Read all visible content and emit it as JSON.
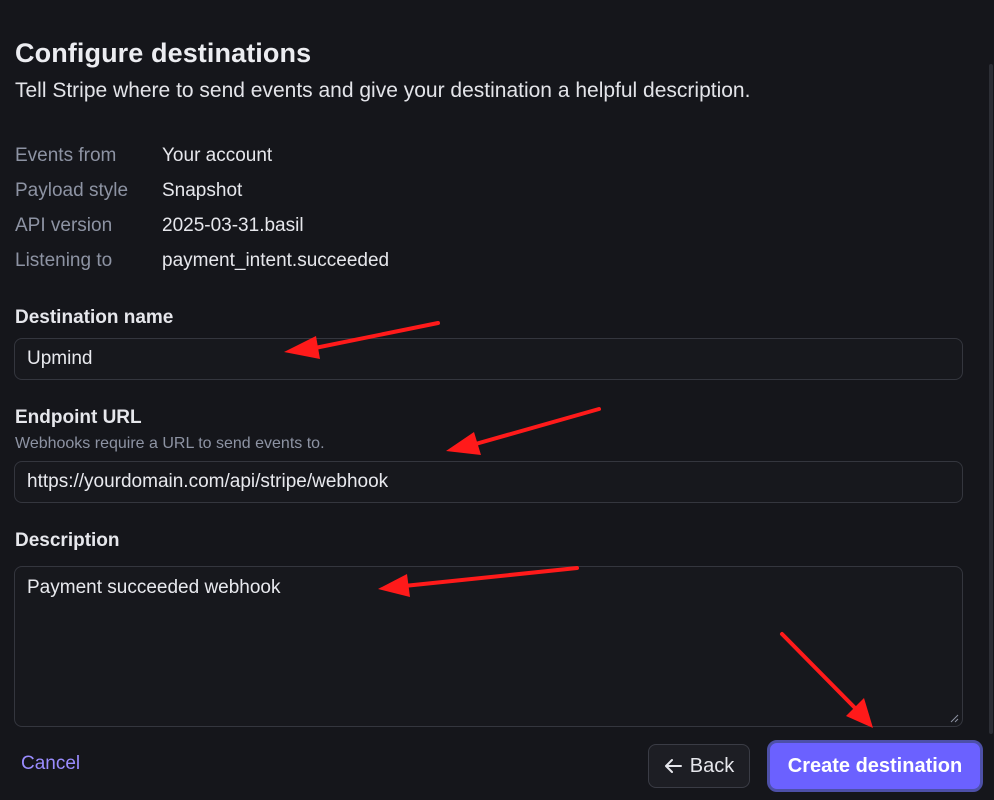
{
  "header": {
    "title": "Configure destinations",
    "subtitle": "Tell Stripe where to send events and give your destination a helpful description."
  },
  "meta": [
    {
      "label": "Events from",
      "value": "Your account"
    },
    {
      "label": "Payload style",
      "value": "Snapshot"
    },
    {
      "label": "API version",
      "value": "2025-03-31.basil"
    },
    {
      "label": "Listening to",
      "value": "payment_intent.succeeded"
    }
  ],
  "form": {
    "destination_name": {
      "label": "Destination name",
      "value": "Upmind"
    },
    "endpoint_url": {
      "label": "Endpoint URL",
      "help": "Webhooks require a URL to send events to.",
      "value": "https://yourdomain.com/api/stripe/webhook"
    },
    "description": {
      "label": "Description",
      "value": "Payment succeeded webhook"
    }
  },
  "footer": {
    "cancel_label": "Cancel",
    "back_label": "Back",
    "create_label": "Create destination"
  },
  "colors": {
    "background": "#15161b",
    "accent": "#6b61ff",
    "link": "#9a8cff",
    "annotation_arrow": "#ff1a1a"
  }
}
